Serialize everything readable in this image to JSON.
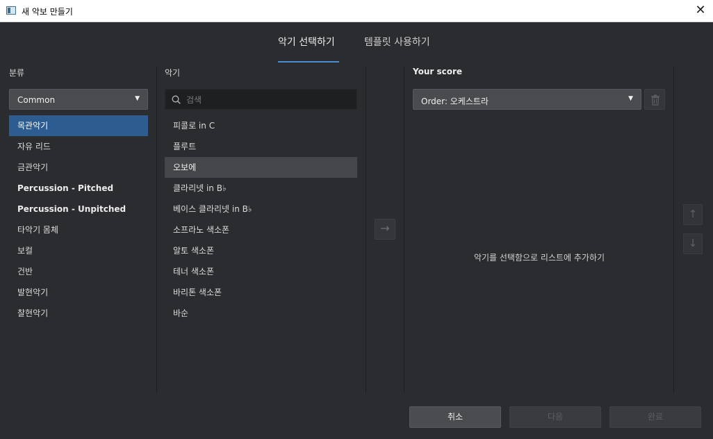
{
  "window": {
    "title": "새 악보 만들기",
    "close_glyph": "✕"
  },
  "tabs": [
    {
      "label": "악기 선택하기",
      "active": true
    },
    {
      "label": "템플릿 사용하기",
      "active": false
    }
  ],
  "categories": {
    "label": "분류",
    "dropdown_value": "Common",
    "items": [
      {
        "label": "목관악기",
        "selected": true,
        "bold": false
      },
      {
        "label": "자유 리드",
        "selected": false,
        "bold": false
      },
      {
        "label": "금관악기",
        "selected": false,
        "bold": false
      },
      {
        "label": "Percussion - Pitched",
        "selected": false,
        "bold": true
      },
      {
        "label": "Percussion - Unpitched",
        "selected": false,
        "bold": true
      },
      {
        "label": "타악기 몸체",
        "selected": false,
        "bold": false
      },
      {
        "label": "보컬",
        "selected": false,
        "bold": false
      },
      {
        "label": "건반",
        "selected": false,
        "bold": false
      },
      {
        "label": "발현악기",
        "selected": false,
        "bold": false
      },
      {
        "label": "찰현악기",
        "selected": false,
        "bold": false
      }
    ]
  },
  "instruments": {
    "label": "악기",
    "search_placeholder": "검색",
    "items": [
      {
        "label": "피콜로 in C",
        "selected": false
      },
      {
        "label": "플루트",
        "selected": false
      },
      {
        "label": "오보에",
        "selected": true
      },
      {
        "label": "클라리넷  in B♭",
        "selected": false
      },
      {
        "label": "베이스 클라리넷  in B♭",
        "selected": false
      },
      {
        "label": "소프라노 색소폰",
        "selected": false
      },
      {
        "label": "알토 색소폰",
        "selected": false
      },
      {
        "label": "테너 색소폰",
        "selected": false
      },
      {
        "label": "바리톤 색소폰",
        "selected": false
      },
      {
        "label": "바순",
        "selected": false
      }
    ]
  },
  "add_button_glyph": "→",
  "score": {
    "label": "Your score",
    "order_value": "Order: 오케스트라",
    "empty_hint": "악기를 선택함으로 리스트에 추가하기"
  },
  "move_up_glyph": "↑",
  "move_down_glyph": "↓",
  "footer": {
    "cancel": "취소",
    "next": "다음",
    "finish": "완료"
  },
  "colors": {
    "accent": "#4a8fd6",
    "selected_category": "#2c5c90",
    "background": "#2b2c2f"
  }
}
